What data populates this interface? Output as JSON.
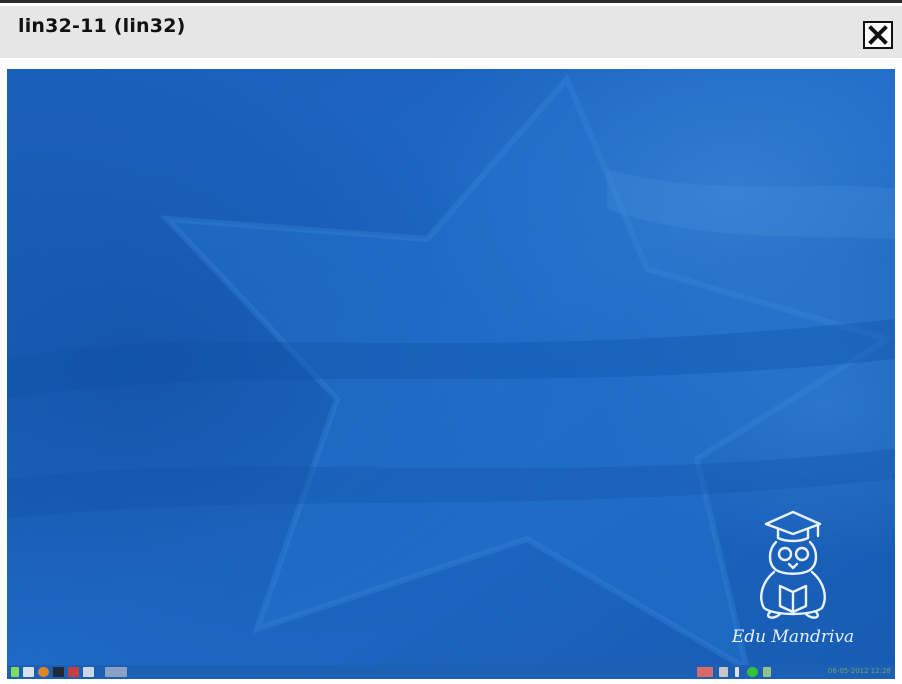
{
  "window": {
    "title": "lin32-11 (lin32)"
  },
  "desktop": {
    "brand_text": "Edu Mandriva",
    "logo": "penguin-graduate-logo",
    "wallpaper": "blue-star-background"
  },
  "taskbar": {
    "launchers": [
      "menu-icon",
      "files-icon",
      "browser-icon",
      "terminal-icon",
      "display-icon",
      "network-icon",
      "window-icon"
    ],
    "tray": [
      "language-flag-icon",
      "keyboard-icon",
      "volume-icon",
      "update-icon",
      "network-status-icon"
    ],
    "clock": "06-05-2012 12:28"
  },
  "colors": {
    "titlebar": "#e6e6e6",
    "desktop_blue": "#1e66c0",
    "desktop_dark": "#0f4aa0"
  }
}
